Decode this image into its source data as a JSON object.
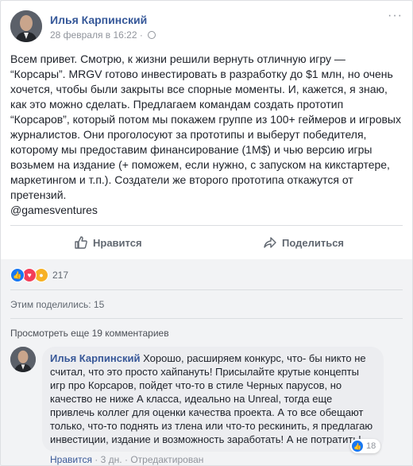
{
  "post": {
    "author": "Илья Карпинский",
    "date": "28 февраля в 16:22",
    "dot": "·",
    "more": "···",
    "text": [
      "Всем привет. Смотрю, к жизни решили вернуть отличную игру —",
      "“Корсары”. MRGV готово инвестировать в разработку до $1 млн, но очень",
      "хочется, чтобы были закрыты все спорные моменты. И, кажется, я знаю,",
      "как это можно сделать. Предлагаем командам создать прототип",
      "“Корсаров”, который потом мы покажем группе из 100+ геймеров и игровых",
      "журналистов. Они проголосуют за прототипы и выберут победителя,",
      "которому мы предоставим финансирование (1М$) и чью версию игры",
      "возьмем на издание (+ поможем, если нужно, с запуском на кикстартере,",
      "маркетингом и т.п.). Создатели же второго прототипа откажутся от",
      "претензий.",
      "@gamesventures"
    ]
  },
  "actions": {
    "like": "Нравится",
    "share": "Поделиться"
  },
  "reactions": {
    "count": "217",
    "icons": [
      "like-icon",
      "love-icon",
      "wow-icon"
    ],
    "colors": {
      "like": "#1877f2",
      "love": "#f33e58",
      "wow": "#f7b125"
    }
  },
  "shared": "Этим поделились: 15",
  "more_comments": "Просмотреть еще 19 комментариев",
  "comment": {
    "author": "Илья Карпинский",
    "text": "Хорошо, расширяем конкурс, что- бы никто не считал, что это просто хайпануть! Присылайте крутые концепты игр про Корсаров, пойдет что-то в стиле Черных парусов, но качество не ниже А класса, идеально на Unreal, тогда еще привлечь коллег для оценки качества проекта. А то все обещают только, что-то поднять из тлена или что-то рескинить, я предлагаю инвестиции, издание и возможность заработать! А не потратить!",
    "reaction_count": "18",
    "like": "Нравится",
    "age": "3 дн.",
    "edited": "Отредактирован",
    "sep": "·"
  },
  "colors": {
    "link": "#365899",
    "muted": "#90949c",
    "background": "#f2f3f5"
  }
}
